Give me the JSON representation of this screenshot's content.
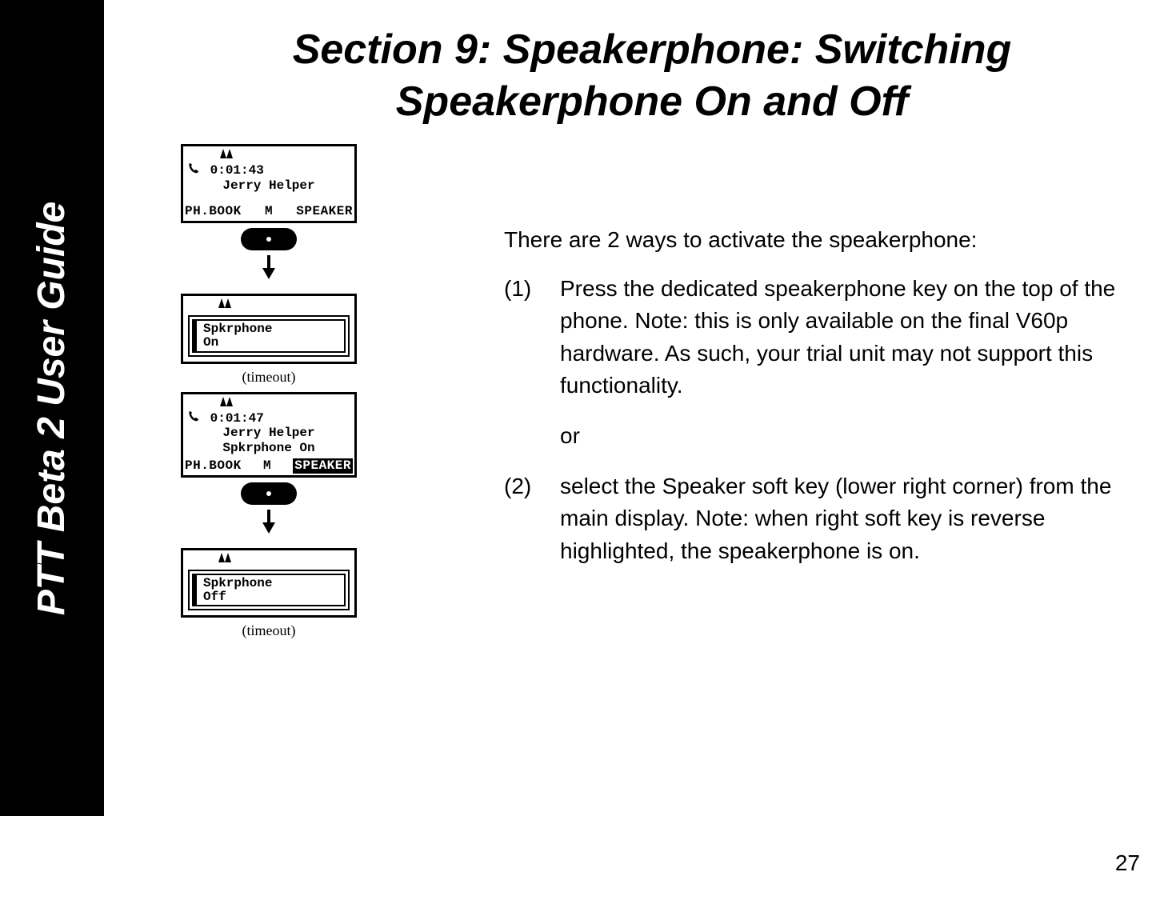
{
  "sidebar": {
    "title": "PTT Beta 2 User Guide"
  },
  "heading": "Section 9: Speakerphone: Switching Speakerphone On and Off",
  "intro": "There are 2 ways to activate the speakerphone:",
  "items": [
    {
      "num": "(1)",
      "text": "Press the dedicated speakerphone key on the top of the phone.  Note: this is only available on the final V60p hardware.  As such, your trial unit may not support this functionality."
    },
    {
      "num": "(2)",
      "text": "select the Speaker soft key (lower right corner)  from the main display.  Note: when right soft key is reverse highlighted, the speakerphone is on."
    }
  ],
  "or_label": "or",
  "screens": {
    "s1": {
      "time": "0:01:43",
      "name": "Jerry Helper",
      "soft_left": "PH.BOOK",
      "soft_mid": "M",
      "soft_right": "SPEAKER"
    },
    "popup_on": {
      "line1": "Spkrphone",
      "line2": "On"
    },
    "timeout1": "(timeout)",
    "s2": {
      "time": "0:01:47",
      "name": "Jerry Helper",
      "status": "Spkrphone On",
      "soft_left": "PH.BOOK",
      "soft_mid": "M",
      "soft_right": "SPEAKER"
    },
    "popup_off": {
      "line1": "Spkrphone",
      "line2": "Off"
    },
    "timeout2": "(timeout)"
  },
  "page_number": "27"
}
